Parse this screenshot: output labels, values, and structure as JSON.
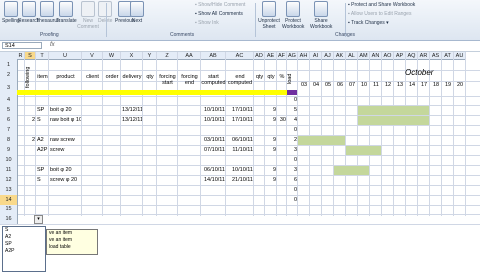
{
  "ribbon": {
    "buttons": [
      {
        "label": "Spelling",
        "disabled": false
      },
      {
        "label": "Research",
        "disabled": false
      },
      {
        "label": "Thesaurus",
        "disabled": false
      },
      {
        "label": "Translate",
        "disabled": false
      },
      {
        "label": "New Comment",
        "disabled": true
      },
      {
        "label": "Delete",
        "disabled": true
      },
      {
        "label": "Previous",
        "disabled": false
      },
      {
        "label": "Next",
        "disabled": false
      },
      {
        "label": "Unprotect Sheet",
        "disabled": false
      },
      {
        "label": "Protect Workbook",
        "disabled": false
      },
      {
        "label": "Share Workbook",
        "disabled": false
      }
    ],
    "small": [
      {
        "label": "Show/Hide Comment",
        "disabled": true
      },
      {
        "label": "Show All Comments",
        "disabled": false
      },
      {
        "label": "Show Ink",
        "disabled": true
      },
      {
        "label": "Protect and Share Workbook",
        "disabled": false
      },
      {
        "label": "Allow Users to Edit Ranges",
        "disabled": true
      },
      {
        "label": "Track Changes ▾",
        "disabled": false
      }
    ],
    "groups": {
      "proofing": "Proofing",
      "comments": "Comments",
      "changes": "Changes"
    }
  },
  "formula_bar": {
    "name_box": "S14",
    "fx": "fx",
    "value": ""
  },
  "columns": [
    "R",
    "S",
    "T",
    "U",
    "V",
    "W",
    "X",
    "Y",
    "Z",
    "AA",
    "AB",
    "AC",
    "AD",
    "AE",
    "AF",
    "AG",
    "AH",
    "AI",
    "AJ",
    "AK",
    "AL",
    "AM",
    "AN",
    "AO",
    "AP",
    "AQ",
    "AR",
    "AS",
    "AT",
    "AU"
  ],
  "gantt_header": {
    "month": "October",
    "days": [
      "03",
      "04",
      "05",
      "06",
      "07",
      "10",
      "11",
      "12",
      "13",
      "14",
      "17",
      "18",
      "19",
      "20",
      "21",
      "2"
    ]
  },
  "headers": [
    "following",
    "item",
    "product",
    "client",
    "order",
    "delivery",
    "qty",
    "forcing start",
    "forcing end",
    "start computed",
    "end computed",
    "qty",
    "qty",
    "%",
    "load"
  ],
  "rows": [
    {
      "n": "1",
      "cells": []
    },
    {
      "n": "2",
      "cells": []
    },
    {
      "n": "3",
      "cells": []
    },
    {
      "n": "4",
      "cells": [
        "",
        "",
        "",
        "",
        "",
        "",
        "",
        "",
        "",
        "",
        "",
        "",
        "",
        "",
        "0"
      ]
    },
    {
      "n": "5",
      "cells": [
        "",
        "SP",
        "boit φ 20",
        "",
        "",
        "13/12/11",
        "",
        "",
        "",
        "10/10/11",
        "17/10/11",
        "",
        "9",
        "",
        "5"
      ]
    },
    {
      "n": "6",
      "cells": [
        "2",
        "S",
        "raw boit φ 10",
        "",
        "",
        "13/12/11",
        "",
        "",
        "",
        "10/10/11",
        "17/10/11",
        "",
        "9",
        "30",
        "4"
      ]
    },
    {
      "n": "7",
      "cells": [
        "",
        "",
        "",
        "",
        "",
        "",
        "",
        "",
        "",
        "",
        "",
        "",
        "",
        "",
        "0"
      ]
    },
    {
      "n": "8",
      "cells": [
        "2",
        "A2",
        "raw screw",
        "",
        "",
        "",
        "",
        "",
        "",
        "03/10/11",
        "06/10/11",
        "",
        "9",
        "",
        "2"
      ]
    },
    {
      "n": "9",
      "cells": [
        "",
        "A2P",
        "screw",
        "",
        "",
        "",
        "",
        "",
        "",
        "07/10/11",
        "11/10/11",
        "",
        "9",
        "",
        "3"
      ]
    },
    {
      "n": "10",
      "cells": [
        "",
        "",
        "",
        "",
        "",
        "",
        "",
        "",
        "",
        "",
        "",
        "",
        "",
        "",
        "0"
      ]
    },
    {
      "n": "11",
      "cells": [
        "",
        "SP",
        "boit φ 20",
        "",
        "",
        "",
        "",
        "",
        "",
        "06/10/11",
        "10/10/11",
        "",
        "9",
        "",
        "3"
      ]
    },
    {
      "n": "12",
      "cells": [
        "",
        "S",
        "screw φ 20",
        "",
        "",
        "",
        "",
        "",
        "",
        "14/10/11",
        "21/10/11",
        "",
        "9",
        "",
        "6"
      ]
    },
    {
      "n": "13",
      "cells": [
        "",
        "",
        "",
        "",
        "",
        "",
        "",
        "",
        "",
        "",
        "",
        "",
        "",
        "",
        "0"
      ]
    },
    {
      "n": "14",
      "cells": [
        "",
        "",
        "",
        "",
        "",
        "",
        "",
        "",
        "",
        "",
        "",
        "",
        "",
        "",
        "0"
      ]
    },
    {
      "n": "15",
      "cells": []
    },
    {
      "n": "16",
      "cells": []
    }
  ],
  "dropdown": [
    "S",
    "A2",
    "SP",
    "A2P"
  ],
  "tooltip": [
    "ve an item",
    "ve an item",
    "load table"
  ],
  "colors": {
    "header_row": "#ffff00",
    "accent_bar": "#7030a0",
    "gantt": "#c4d79b"
  }
}
